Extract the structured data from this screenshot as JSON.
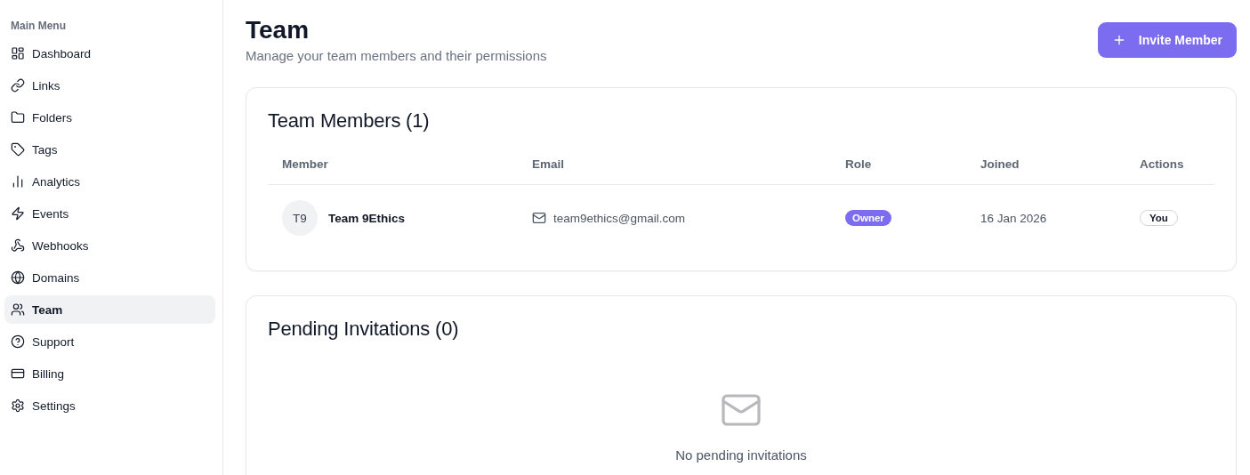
{
  "sidebar": {
    "heading": "Main Menu",
    "items": [
      {
        "label": "Dashboard",
        "selected": false
      },
      {
        "label": "Links",
        "selected": false
      },
      {
        "label": "Folders",
        "selected": false
      },
      {
        "label": "Tags",
        "selected": false
      },
      {
        "label": "Analytics",
        "selected": false
      },
      {
        "label": "Events",
        "selected": false
      },
      {
        "label": "Webhooks",
        "selected": false
      },
      {
        "label": "Domains",
        "selected": false
      },
      {
        "label": "Team",
        "selected": true
      },
      {
        "label": "Support",
        "selected": false
      },
      {
        "label": "Billing",
        "selected": false
      },
      {
        "label": "Settings",
        "selected": false
      }
    ]
  },
  "header": {
    "title": "Team",
    "subtitle": "Manage your team members and their permissions",
    "button": "Invite Member"
  },
  "members_card": {
    "title": "Team Members (1)",
    "columns": [
      "Member",
      "Email",
      "Role",
      "Joined",
      "Actions"
    ],
    "rows": [
      {
        "initials": "T9",
        "name": "Team 9Ethics",
        "email": "team9ethics@gmail.com",
        "role": "Owner",
        "joined": "16 Jan 2026",
        "action": "You"
      }
    ]
  },
  "invitations_card": {
    "title": "Pending Invitations (0)",
    "empty_text": "No pending invitations"
  }
}
